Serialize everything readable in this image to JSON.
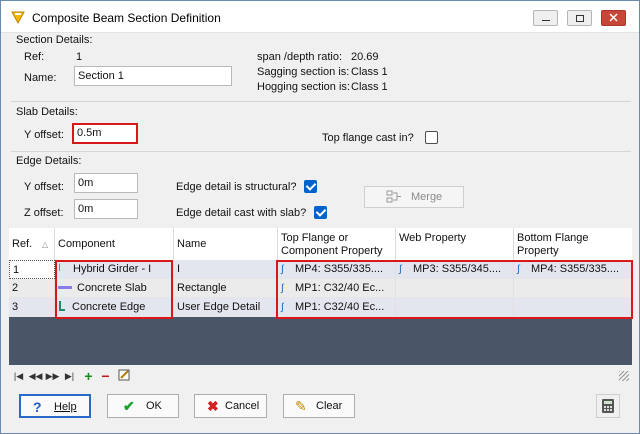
{
  "window": {
    "title": "Composite Beam Section Definition"
  },
  "section_details": {
    "heading": "Section Details:",
    "ref_label": "Ref:",
    "ref_value": "1",
    "name_label": "Name:",
    "name_value": "Section 1",
    "span_depth_label": "span /depth ratio:",
    "span_depth_value": "20.69",
    "sagging_label": "Sagging section is:",
    "sagging_value": "Class 1",
    "hogging_label": "Hogging section is:",
    "hogging_value": "Class 1"
  },
  "slab_details": {
    "heading": "Slab Details:",
    "y_offset_label": "Y offset:",
    "y_offset_value": "0.5m",
    "top_flange_label": "Top flange cast in?",
    "top_flange_checked": false
  },
  "edge_details": {
    "heading": "Edge Details:",
    "y_offset_label": "Y offset:",
    "y_offset_value": "0m",
    "z_offset_label": "Z offset:",
    "z_offset_value": "0m",
    "structural_label": "Edge detail is structural?",
    "structural_checked": true,
    "cast_with_slab_label": "Edge detail cast with slab?",
    "cast_with_slab_checked": true,
    "merge_label": "Merge"
  },
  "table": {
    "headers": {
      "ref": "Ref.",
      "component": "Component",
      "name": "Name",
      "top_flange": "Top Flange or Component Property",
      "web": "Web Property",
      "bottom_flange": "Bottom Flange Property"
    },
    "rows": [
      {
        "ref": "1",
        "component": "Hybrid Girder - I",
        "icon": "i-beam-icon",
        "name": "I",
        "top_flange": "MP4: S355/335....",
        "web": "MP3: S355/345....",
        "bottom_flange": "MP4: S355/335...."
      },
      {
        "ref": "2",
        "component": "Concrete Slab",
        "icon": "slab-icon",
        "name": "Rectangle",
        "top_flange": "MP1: C32/40 Ec...",
        "web": "",
        "bottom_flange": ""
      },
      {
        "ref": "3",
        "component": "Concrete Edge",
        "icon": "edge-icon",
        "name": "User Edge Detail",
        "top_flange": "MP1: C32/40 Ec...",
        "web": "",
        "bottom_flange": ""
      }
    ]
  },
  "buttons": {
    "help": "Help",
    "ok": "OK",
    "cancel": "Cancel",
    "clear": "Clear"
  },
  "colors": {
    "highlight": "#d8171b",
    "checkbox": "#0063c9",
    "grid_background": "#4a5568"
  }
}
